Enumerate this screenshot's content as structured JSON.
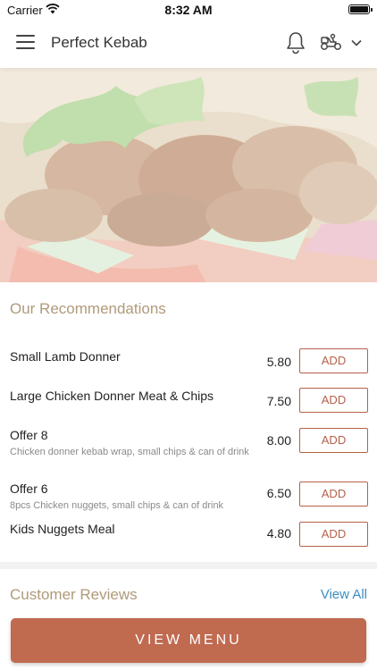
{
  "status_bar": {
    "carrier": "Carrier",
    "time": "8:32 AM"
  },
  "header": {
    "title": "Perfect Kebab",
    "icons": [
      "menu-icon",
      "bell-icon",
      "delivery-icon",
      "chevron-down-icon"
    ]
  },
  "recommendations": {
    "title": "Our Recommendations",
    "items": [
      {
        "name": "Small Lamb Donner",
        "description": "",
        "price": "5.80",
        "add_label": "ADD"
      },
      {
        "name": "Large Chicken Donner Meat & Chips",
        "description": "",
        "price": "7.50",
        "add_label": "ADD"
      },
      {
        "name": "Offer 8",
        "description": "Chicken donner kebab wrap, small chips & can of drink",
        "price": "8.00",
        "add_label": "ADD"
      },
      {
        "name": "Offer 6",
        "description": "8pcs Chicken nuggets, small chips & can of drink",
        "price": "6.50",
        "add_label": "ADD"
      },
      {
        "name": "Kids Nuggets Meal",
        "description": "",
        "price": "4.80",
        "add_label": "ADD"
      }
    ]
  },
  "reviews": {
    "title": "Customer Reviews",
    "view_all_label": "View All"
  },
  "footer": {
    "view_menu_label": "VIEW MENU"
  },
  "colors": {
    "accent": "#c06a50",
    "accent_border": "#b5614a",
    "section_title": "#b09a7a",
    "link": "#3a8ec2"
  }
}
